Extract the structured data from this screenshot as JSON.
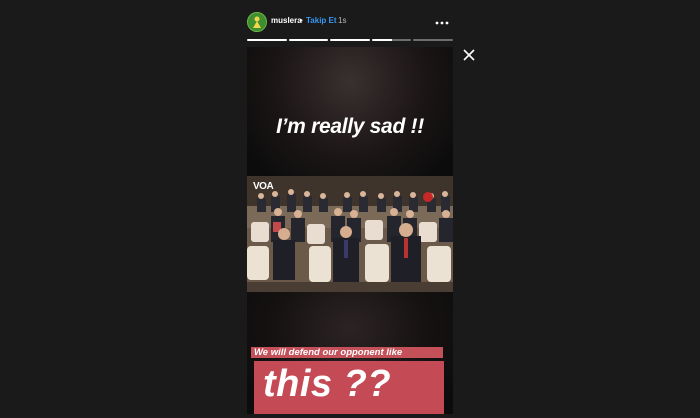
{
  "header": {
    "username": "muslera",
    "separator": "•",
    "follow_label": "Takip Et",
    "time_ago": "1s",
    "avatar_icon": "profile-avatar-icon",
    "more_icon": "more-options-icon"
  },
  "progress": {
    "segments": [
      1,
      1,
      1,
      0.5,
      0
    ],
    "active_color": "#ffffff",
    "inactive_color": "#6e6e6e"
  },
  "close_icon": "close-icon",
  "story": {
    "caption_top": "I’m really sad !!",
    "video": {
      "logo_text": "VOA"
    },
    "caption_line1": "We will defend our opponent like",
    "caption_line2": "this ??",
    "caption_bg_color": "#c44a55"
  },
  "colors": {
    "background": "#1a1a1a",
    "accent_link": "#3897f0"
  }
}
